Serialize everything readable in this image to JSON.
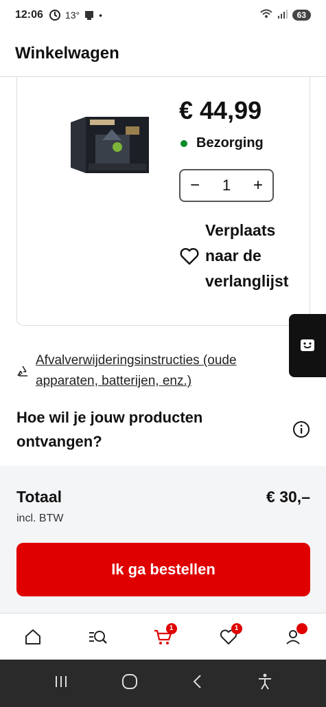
{
  "status_bar": {
    "time": "12:06",
    "temperature": "13°",
    "battery": "63"
  },
  "header": {
    "title": "Winkelwagen"
  },
  "product": {
    "price": "€ 44,99",
    "delivery_label": "Bezorging",
    "delivery_color": "#0a8a2a",
    "quantity": "1",
    "wishlist_label": "Verplaats naar de verlanglijst"
  },
  "disposal_link": "Afvalverwijderingsinstructies (oude apparaten, batterijen, enz.)",
  "delivery_question": "Hoe wil je jouw producten ontvangen?",
  "summary": {
    "total_label": "Totaal",
    "total_value": "€ 30,–",
    "vat_label": "incl. BTW"
  },
  "order_button": "Ik ga bestellen",
  "bottom_nav": {
    "items": [
      {
        "icon": "home-icon"
      },
      {
        "icon": "search-icon"
      },
      {
        "icon": "cart-icon",
        "badge": "1"
      },
      {
        "icon": "heart-icon",
        "badge": "1"
      },
      {
        "icon": "account-icon"
      }
    ]
  },
  "colors": {
    "accent": "#df0000",
    "text": "#111111",
    "panel": "#f4f5f7"
  }
}
